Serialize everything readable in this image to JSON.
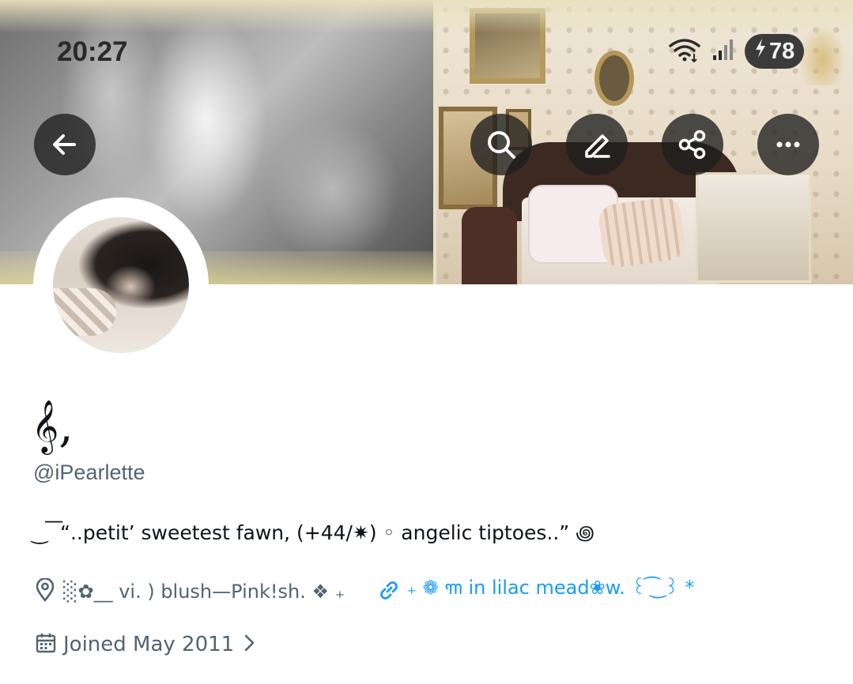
{
  "status_bar": {
    "time": "20:27",
    "battery_level": "78",
    "icons": [
      "wifi-icon",
      "signal-icon",
      "battery-charging-icon"
    ]
  },
  "header": {
    "back_icon": "back-arrow-icon",
    "actions": [
      "search-icon",
      "edit-icon",
      "share-icon",
      "more-icon"
    ]
  },
  "profile": {
    "display_name": "𝄞,",
    "handle": "@iPearlette",
    "bio": "‿  ͞  “..petit’ sweetest fawn, (+44/✷) ◦  angelic tiptoes..”  ꩜",
    "location": "░✿__  vi.  )  blush—Pink!sh.  ❖  ₊",
    "link": "₊ ❁  ꧑  in  lilac  mead❀w.  ꒰ ͡ ͜ ꒱  *",
    "joined": "Joined May 2011"
  },
  "colors": {
    "text_primary": "#0f1419",
    "text_secondary": "#536471",
    "link": "#1d9bf0",
    "overlay_button": "#1e1e1e"
  }
}
